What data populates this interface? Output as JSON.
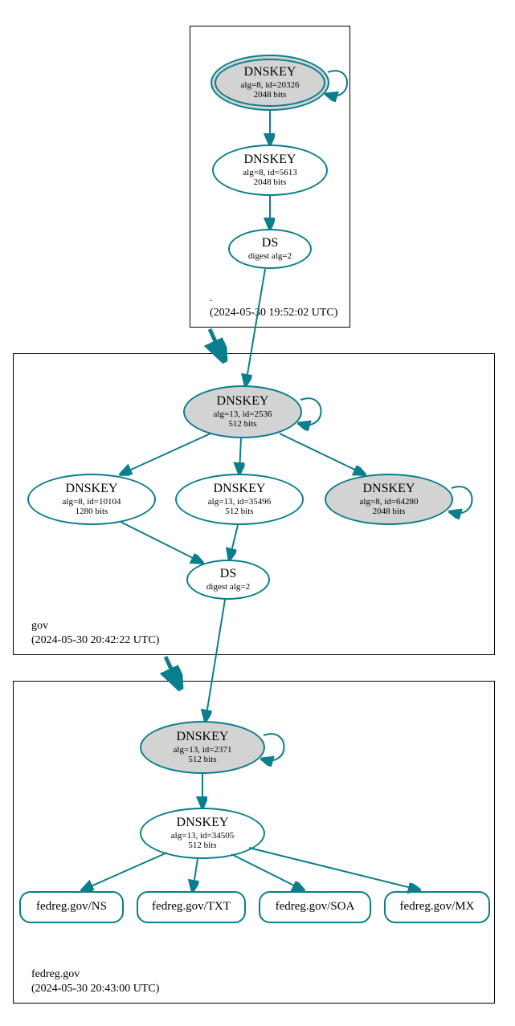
{
  "zones": {
    "root": {
      "name": ".",
      "timestamp": "(2024-05-30 19:52:02 UTC)"
    },
    "gov": {
      "name": "gov",
      "timestamp": "(2024-05-30 20:42:22 UTC)"
    },
    "fedreg": {
      "name": "fedreg.gov",
      "timestamp": "(2024-05-30 20:43:00 UTC)"
    }
  },
  "nodes": {
    "root_ksk": {
      "title": "DNSKEY",
      "line2": "alg=8, id=20326",
      "line3": "2048 bits"
    },
    "root_zsk": {
      "title": "DNSKEY",
      "line2": "alg=8, id=5613",
      "line3": "2048 bits"
    },
    "root_ds": {
      "title": "DS",
      "line2": "digest alg=2"
    },
    "gov_ksk": {
      "title": "DNSKEY",
      "line2": "alg=13, id=2536",
      "line3": "512 bits"
    },
    "gov_k1": {
      "title": "DNSKEY",
      "line2": "alg=8, id=10104",
      "line3": "1280 bits"
    },
    "gov_k2": {
      "title": "DNSKEY",
      "line2": "alg=13, id=35496",
      "line3": "512 bits"
    },
    "gov_k3": {
      "title": "DNSKEY",
      "line2": "alg=8, id=64280",
      "line3": "2048 bits"
    },
    "gov_ds": {
      "title": "DS",
      "line2": "digest alg=2"
    },
    "fed_ksk": {
      "title": "DNSKEY",
      "line2": "alg=13, id=2371",
      "line3": "512 bits"
    },
    "fed_zsk": {
      "title": "DNSKEY",
      "line2": "alg=13, id=34505",
      "line3": "512 bits"
    },
    "rr_ns": {
      "title": "fedreg.gov/NS"
    },
    "rr_txt": {
      "title": "fedreg.gov/TXT"
    },
    "rr_soa": {
      "title": "fedreg.gov/SOA"
    },
    "rr_mx": {
      "title": "fedreg.gov/MX"
    }
  }
}
